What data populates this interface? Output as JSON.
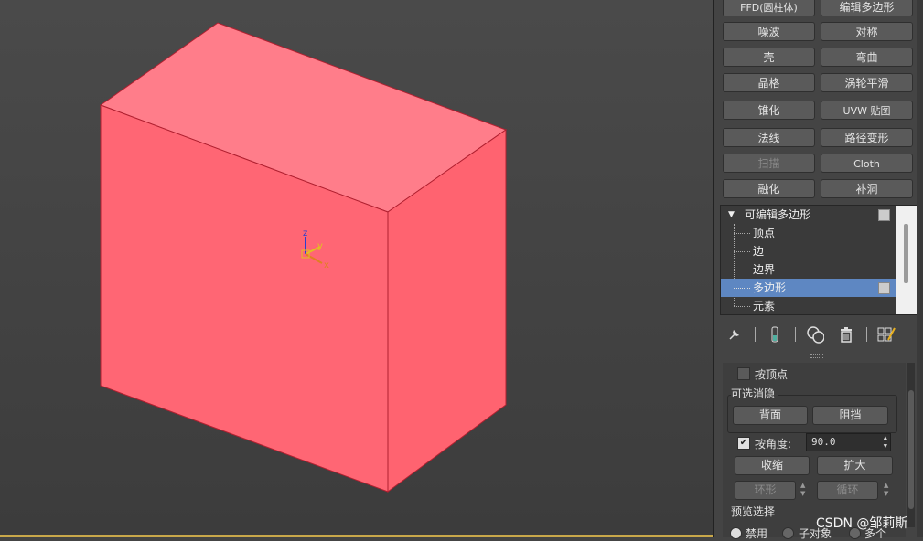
{
  "viewport": {
    "gizmo": {
      "z": "z",
      "y": "y",
      "x": "x"
    }
  },
  "modifier_buttons": [
    "FFD(圆柱体)",
    "编辑多边形",
    "噪波",
    "对称",
    "壳",
    "弯曲",
    "晶格",
    "涡轮平滑",
    "锥化",
    "UVW 贴图",
    "法线",
    "路径变形",
    "扫描",
    "Cloth",
    "融化",
    "补洞"
  ],
  "stack": {
    "root": "可编辑多边形",
    "items": [
      "顶点",
      "边",
      "边界",
      "多边形",
      "元素"
    ],
    "selected_index": 3
  },
  "selection": {
    "by_vertex": "按顶点",
    "group_title": "可选消隐",
    "backface": "背面",
    "occluded": "阻挡",
    "by_angle": "按角度:",
    "angle_value": "90.0",
    "shrink": "收缩",
    "grow": "扩大",
    "ring": "环形",
    "loop": "循环",
    "preview_title": "预览选择",
    "preview_options": [
      "禁用",
      "子对象",
      "多个"
    ]
  },
  "watermark": "CSDN @邹莉斯",
  "colors": {
    "box_front": "#ff6674",
    "box_top": "#ff7d8a",
    "box_side": "#ff6370",
    "selection_blue": "#5e87c2"
  }
}
